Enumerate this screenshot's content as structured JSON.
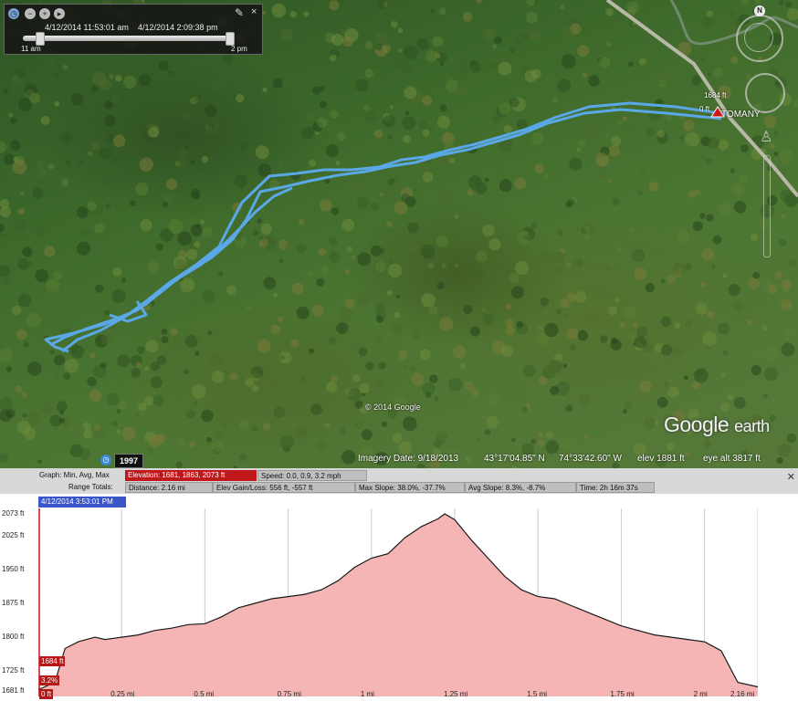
{
  "time_slider": {
    "start_datetime": "4/12/2014  11:53:01 am",
    "end_datetime": "4/12/2014   2:09:38 pm",
    "left_label": "11 am",
    "right_label": "2 pm"
  },
  "map": {
    "placemark_name": "TOMANY",
    "pin_elevation_label": "1684 ft",
    "pin_distance_label": "0 ft",
    "copyright": "© 2014 Google",
    "logo_main": "Google",
    "logo_sub": "earth",
    "compass_label": "N",
    "year_badge": "1997"
  },
  "status_bar": {
    "imagery_date": "Imagery Date: 9/18/2013",
    "latitude": "43°17'04.85\" N",
    "longitude": "74°33'42.60\" W",
    "elevation": "elev  1881 ft",
    "eye_alt": "eye alt  3817 ft"
  },
  "profile": {
    "graph_label": "Graph: Min, Avg, Max",
    "elevation_stat": "Elevation: 1681, 1863, 2073 ft",
    "speed_stat": "Speed: 0.0, 0.9, 3.2 mph",
    "range_totals_label": "Range Totals:",
    "distance_stat": "Distance: 2.16 mi",
    "elev_gain_loss": "Elev Gain/Loss: 556 ft, -557 ft",
    "max_slope": "Max Slope: 38.0%, -37.7%",
    "avg_slope": "Avg Slope: 8.3%, -8.7%",
    "time_stat": "Time: 2h 16m 37s",
    "cursor_timestamp": "4/12/2014 3:53:01 PM",
    "cursor_elevation": "1684 ft",
    "cursor_slope": "3.2%",
    "cursor_distance": "0 ft",
    "close_icon": "close-icon"
  },
  "colors": {
    "track": "#5aa8e8",
    "profile_fill": "#f5b5b5",
    "profile_line": "#1a1a1a",
    "accent_red": "#c0171b",
    "accent_blue": "#3a55c8"
  },
  "chart_data": {
    "type": "area",
    "xlabel": "",
    "ylabel": "",
    "x_ticks": [
      "0.25 mi",
      "0.5 mi",
      "0.75 mi",
      "1 mi",
      "1.25 mi",
      "1.5 mi",
      "1.75 mi",
      "2 mi",
      "2.16 mi"
    ],
    "x_tick_values": [
      0.25,
      0.5,
      0.75,
      1,
      1.25,
      1.5,
      1.75,
      2,
      2.16
    ],
    "y_ticks": [
      "1681 ft",
      "1725 ft",
      "1800 ft",
      "1875 ft",
      "1950 ft",
      "2025 ft",
      "2073 ft"
    ],
    "y_tick_values": [
      1681,
      1725,
      1800,
      1875,
      1950,
      2025,
      2073
    ],
    "xlim": [
      0,
      2.16
    ],
    "ylim": [
      1681,
      2073
    ],
    "grid": true,
    "series": [
      {
        "x": [
          0,
          0.05,
          0.08,
          0.12,
          0.17,
          0.2,
          0.25,
          0.3,
          0.35,
          0.4,
          0.45,
          0.5,
          0.55,
          0.6,
          0.65,
          0.7,
          0.75,
          0.8,
          0.85,
          0.9,
          0.95,
          1.0,
          1.05,
          1.1,
          1.15,
          1.2,
          1.22,
          1.25,
          1.3,
          1.35,
          1.4,
          1.45,
          1.5,
          1.55,
          1.6,
          1.65,
          1.7,
          1.75,
          1.8,
          1.85,
          1.9,
          1.95,
          2.0,
          2.05,
          2.1,
          2.16
        ],
        "y": [
          1684,
          1700,
          1775,
          1790,
          1800,
          1795,
          1800,
          1805,
          1815,
          1820,
          1828,
          1830,
          1845,
          1865,
          1875,
          1885,
          1890,
          1895,
          1905,
          1925,
          1955,
          1975,
          1985,
          2020,
          2045,
          2062,
          2073,
          2060,
          2015,
          1975,
          1935,
          1905,
          1890,
          1885,
          1870,
          1855,
          1840,
          1825,
          1815,
          1805,
          1800,
          1795,
          1790,
          1770,
          1700,
          1690
        ]
      }
    ]
  }
}
